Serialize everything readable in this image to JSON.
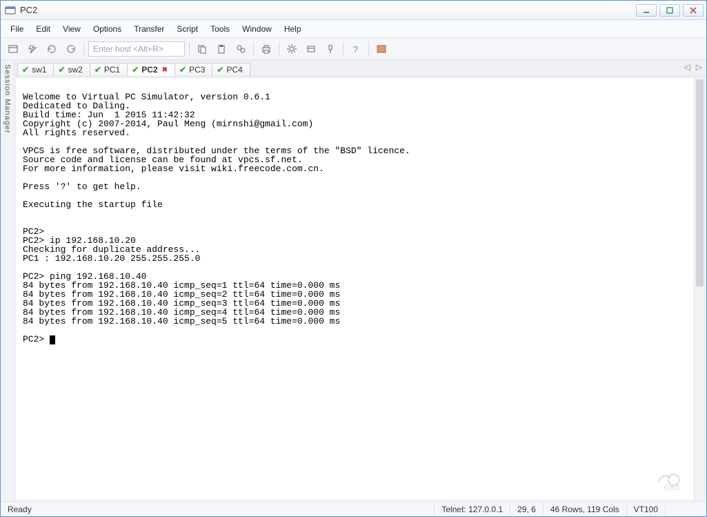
{
  "window": {
    "title": "PC2"
  },
  "menu": {
    "items": [
      "File",
      "Edit",
      "View",
      "Options",
      "Transfer",
      "Script",
      "Tools",
      "Window",
      "Help"
    ]
  },
  "toolbar": {
    "host_placeholder": "Enter host <Alt+R>"
  },
  "sidebar": {
    "label": "Session Manager"
  },
  "tabs": [
    {
      "label": "sw1",
      "active": false
    },
    {
      "label": "sw2",
      "active": false
    },
    {
      "label": "PC1",
      "active": false
    },
    {
      "label": "PC2",
      "active": true,
      "closable": true
    },
    {
      "label": "PC3",
      "active": false
    },
    {
      "label": "PC4",
      "active": false
    }
  ],
  "terminal": {
    "lines": [
      "",
      "Welcome to Virtual PC Simulator, version 0.6.1",
      "Dedicated to Daling.",
      "Build time: Jun  1 2015 11:42:32",
      "Copyright (c) 2007-2014, Paul Meng (mirnshi@gmail.com)",
      "All rights reserved.",
      "",
      "VPCS is free software, distributed under the terms of the \"BSD\" licence.",
      "Source code and license can be found at vpcs.sf.net.",
      "For more information, please visit wiki.freecode.com.cn.",
      "",
      "Press '?' to get help.",
      "",
      "Executing the startup file",
      "",
      "",
      "PC2>",
      "PC2> ip 192.168.10.20",
      "Checking for duplicate address...",
      "PC1 : 192.168.10.20 255.255.255.0",
      "",
      "PC2> ping 192.168.10.40",
      "84 bytes from 192.168.10.40 icmp_seq=1 ttl=64 time=0.000 ms",
      "84 bytes from 192.168.10.40 icmp_seq=2 ttl=64 time=0.000 ms",
      "84 bytes from 192.168.10.40 icmp_seq=3 ttl=64 time=0.000 ms",
      "84 bytes from 192.168.10.40 icmp_seq=4 ttl=64 time=0.000 ms",
      "84 bytes from 192.168.10.40 icmp_seq=5 ttl=64 time=0.000 ms",
      "",
      "PC2> "
    ]
  },
  "status": {
    "ready": "Ready",
    "connection": "Telnet: 127.0.0.1",
    "cursor": "29,   6",
    "size": "46 Rows, 119 Cols",
    "emu": "VT100"
  },
  "watermark": {
    "text": "亿速云"
  }
}
